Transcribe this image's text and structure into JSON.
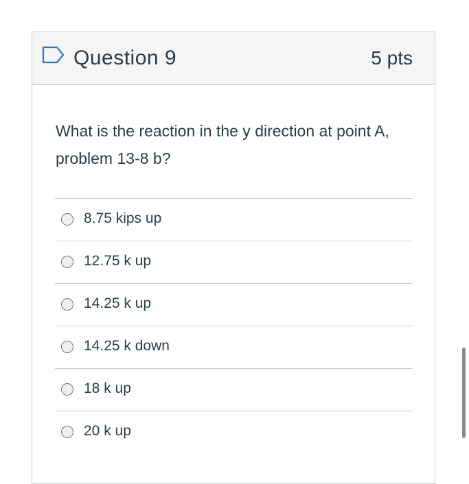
{
  "question": {
    "title": "Question 9",
    "points": "5 pts",
    "text": "What is the reaction in the y direction at point A, problem 13-8 b?",
    "flag_icon": "flag-icon"
  },
  "answers": [
    {
      "label": "8.75 kips up",
      "selected": false
    },
    {
      "label": "12.75 k up",
      "selected": false
    },
    {
      "label": "14.25 k up",
      "selected": false
    },
    {
      "label": "14.25 k down",
      "selected": false
    },
    {
      "label": "18 k up",
      "selected": false
    },
    {
      "label": "20 k up",
      "selected": false
    }
  ],
  "colors": {
    "header_bg": "#f5f5f5",
    "border": "#c7cdd1",
    "text": "#2d3b45",
    "flag": "#2b7abc"
  }
}
